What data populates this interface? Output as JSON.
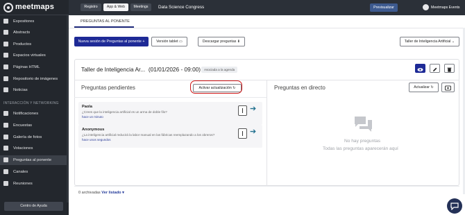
{
  "app": {
    "logo": "meetmaps"
  },
  "sidebar": {
    "items": [
      {
        "label": "Expositores"
      },
      {
        "label": "Abstracts"
      },
      {
        "label": "Productos"
      },
      {
        "label": "Espacios virtuales"
      },
      {
        "label": "Páginas HTML"
      },
      {
        "label": "Repositorio de imágenes"
      },
      {
        "label": "Noticias"
      },
      {
        "label": "Notificaciones"
      },
      {
        "label": "Encuestas"
      },
      {
        "label": "Galería de fotos"
      },
      {
        "label": "Votaciones"
      },
      {
        "label": "Preguntas al ponente"
      },
      {
        "label": "Canales"
      },
      {
        "label": "Reuniones"
      }
    ],
    "section_label": "INTERACCIÓN Y NETWORKING",
    "help_button": "Centro de Ayuda"
  },
  "topbar": {
    "tabs": [
      "Registro",
      "App & Web",
      "Meetings"
    ],
    "active_tab": "App & Web",
    "event_name": "Data Science Congress",
    "preview_label": "Previsualizar",
    "user_name": "Meetmaps Events"
  },
  "page": {
    "tab_label": "PREGUNTAS AL PONENTE",
    "new_session_label": "Nueva sesión de Preguntas al ponente",
    "tablet_label": "Versión tablet",
    "download_label": "Descargar preguntas",
    "session_select": "Taller de Inteligencia Artificial",
    "session_title": "Taller de Inteligencia Ar...",
    "session_datetime": "(01/01/2026 - 09:00)",
    "assoc_badge": "Asociada a la agenda",
    "pending_title": "Preguntas pendientes",
    "activate_label": "Activar actualización",
    "live_title": "Preguntas en directo",
    "update_label": "Actualizar",
    "questions": [
      {
        "author": "Paola",
        "text": "¿Crees que la inteligencia artificial es un arma de doble filo?",
        "time": "hace un minuto"
      },
      {
        "author": "Anonymous",
        "text": "¿La inteligencia artificial reducirá la labor manual en las fábricas reemplazando a los obreros?",
        "time": "hace unos segundos"
      }
    ],
    "empty_title": "No hay preguntas",
    "empty_subtitle": "Todas las preguntas aparecerán aquí",
    "archived_prefix": "0 archivadas",
    "archived_link": "Ver listado"
  }
}
